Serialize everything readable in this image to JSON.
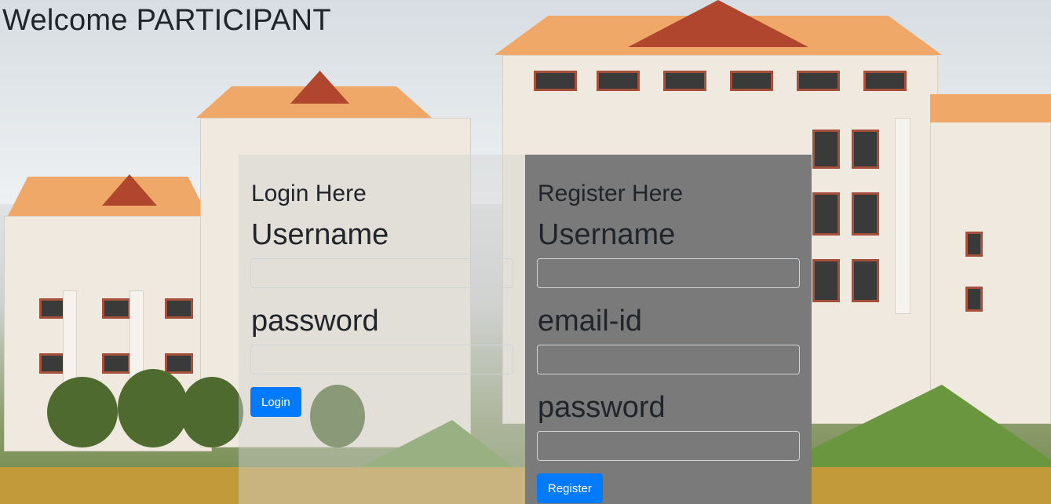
{
  "header": {
    "title": "Welcome PARTICIPANT"
  },
  "login": {
    "heading": "Login Here",
    "username_label": "Username",
    "username_value": "",
    "password_label": "password",
    "password_value": "",
    "submit_label": "Login"
  },
  "register": {
    "heading": "Register Here",
    "username_label": "Username",
    "username_value": "",
    "email_label": "email-id",
    "email_value": "",
    "password_label": "password",
    "password_value": "",
    "submit_label": "Register"
  },
  "colors": {
    "primary_button": "#007bff",
    "register_panel": "#7a7a7a",
    "text": "#212529"
  }
}
